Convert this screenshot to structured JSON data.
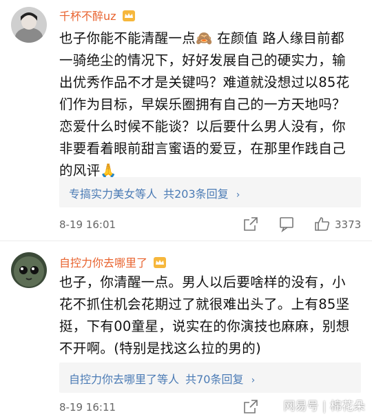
{
  "comments": [
    {
      "username": "千杯不醉uz",
      "text": "也子你能不能清醒一点🙈 在颜值 路人缘目前都一骑绝尘的情况下，好好发展自己的硬实力，输出优秀作品不才是关键吗？难道就没想过以85花们作为目标，早娱乐圈拥有自己的一方天地吗？恋爱什么时候不能谈？以后要什么男人没有，你非要看着眼前甜言蜜语的爱豆，在那里作践自己的风评🙏",
      "reply_names": "专搞实力美女等人",
      "reply_count": "共203条回复",
      "time": "8-19 16:01",
      "likes": "3373"
    },
    {
      "username": "自控力你去哪里了",
      "text": "也子，你清醒一点。男人以后要啥样的没有，小花不抓住机会花期过了就很难出头了。上有85坚挺，下有00童星，说实在的你演技也麻麻，别想不开啊。(特别是找这么拉的男的)",
      "reply_names": "自控力你去哪里了等人",
      "reply_count": "共70条回复",
      "time": "8-19 16:11",
      "likes": ""
    }
  ],
  "watermark": "网易号 | 棉花朵",
  "colors": {
    "username": "#e8632f",
    "link": "#4b7bb5",
    "meta": "#666666"
  }
}
